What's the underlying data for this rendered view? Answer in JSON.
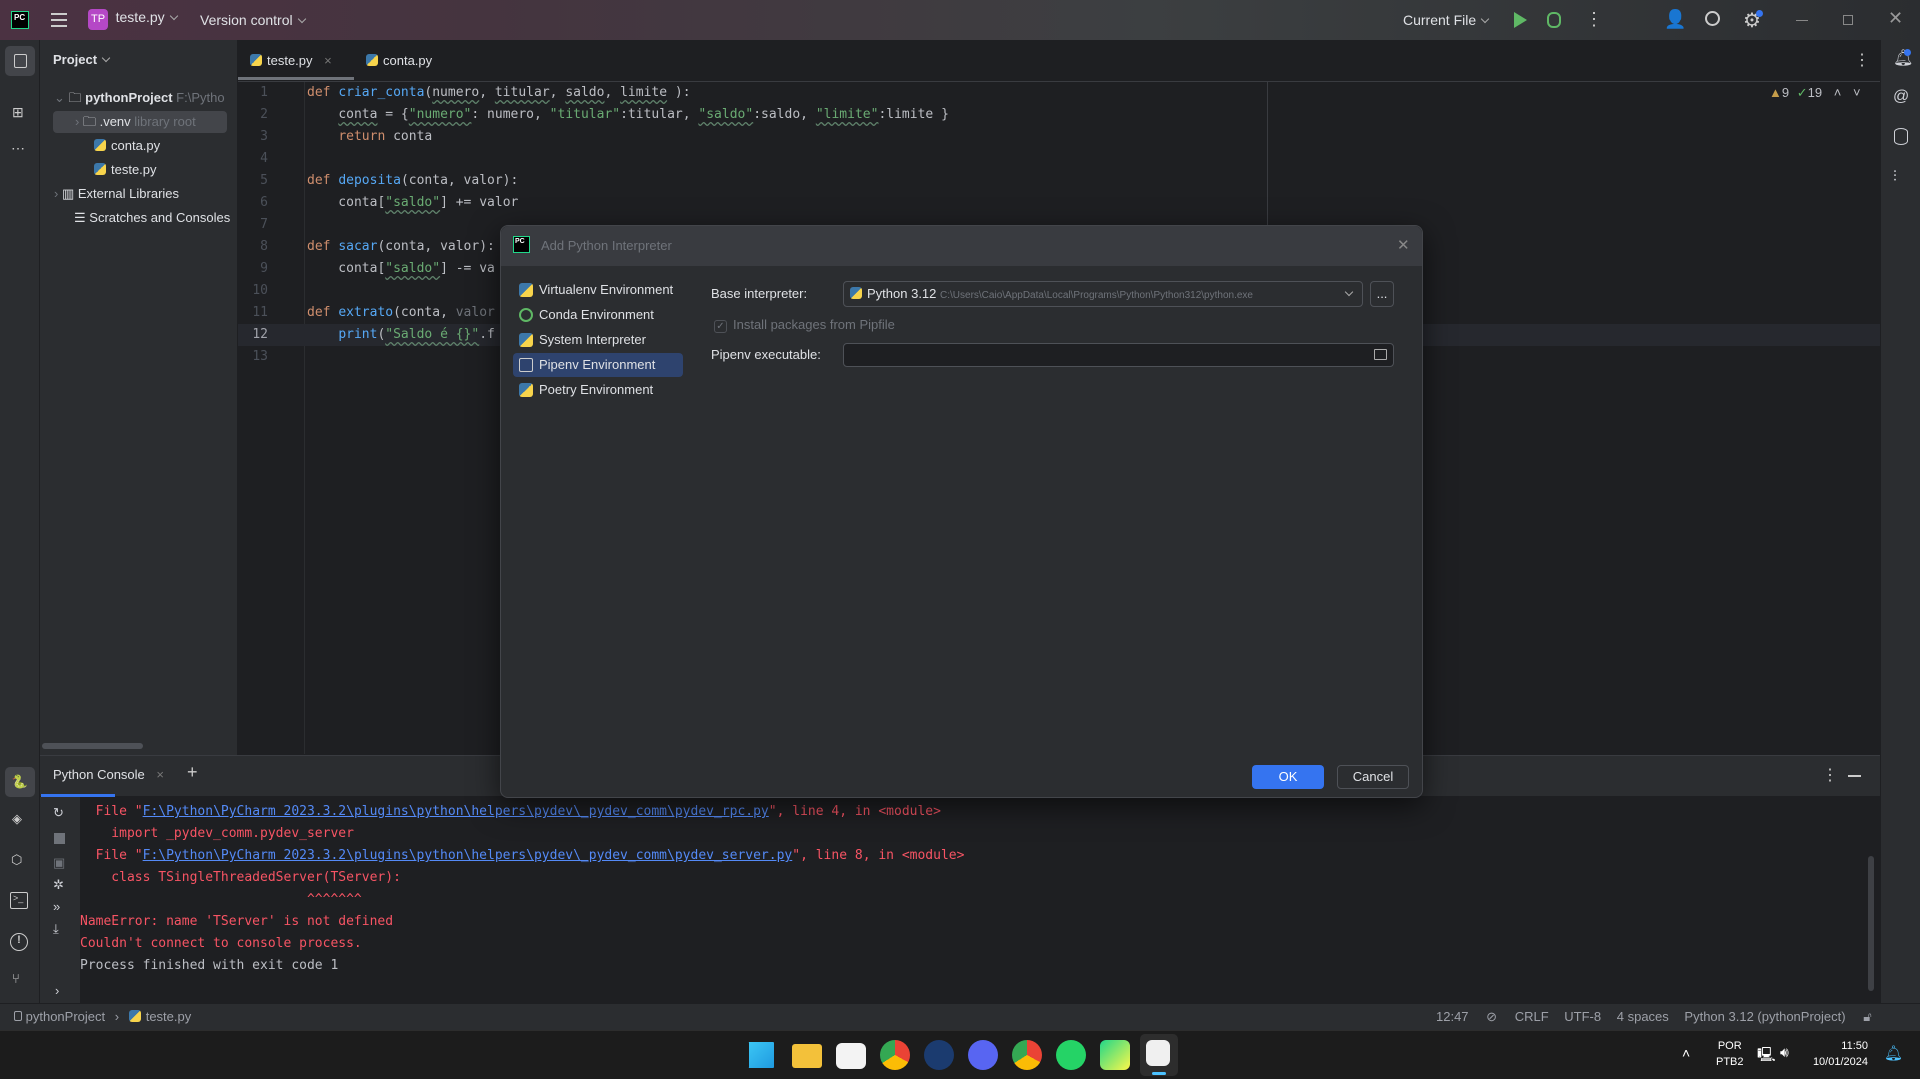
{
  "titlebar": {
    "project_badge": "TP",
    "project_name": "teste.py",
    "vcs": "Version control",
    "run_config": "Current File",
    "icons": [
      "app-logo-icon",
      "hamburger-menu-icon",
      "run-icon",
      "debug-icon",
      "more-icon",
      "add-user-icon",
      "search-icon",
      "settings-icon",
      "minimize-icon",
      "restore-icon",
      "close-icon"
    ]
  },
  "project_panel": {
    "title": "Project",
    "items": [
      {
        "label": "pythonProject",
        "hint": "F:\\Pytho",
        "icon": "folder-icon"
      },
      {
        "label": ".venv",
        "hint": "library root",
        "icon": "folder-icon"
      },
      {
        "label": "conta.py",
        "hint": "",
        "icon": "python-file-icon"
      },
      {
        "label": "teste.py",
        "hint": "",
        "icon": "python-file-icon"
      },
      {
        "label": "External Libraries",
        "hint": "",
        "icon": "library-icon"
      },
      {
        "label": "Scratches and Consoles",
        "hint": "",
        "icon": "scratches-icon"
      }
    ]
  },
  "editor": {
    "tabs": [
      {
        "label": "teste.py",
        "active": true
      },
      {
        "label": "conta.py",
        "active": false
      }
    ],
    "inspections": {
      "warnings": "9",
      "weak_warnings": "19"
    },
    "current_line": 12,
    "lines": [
      [
        [
          "k",
          "def "
        ],
        [
          "f",
          "criar_conta"
        ],
        [
          "p",
          "("
        ],
        [
          "pw",
          "numero"
        ],
        [
          "p",
          ", "
        ],
        [
          "pw",
          "titular"
        ],
        [
          "p",
          ", "
        ],
        [
          "pw",
          "saldo"
        ],
        [
          "p",
          ", "
        ],
        [
          "pw",
          "limite"
        ],
        [
          "p",
          " ):"
        ]
      ],
      [
        [
          "p",
          "    "
        ],
        [
          "pw",
          "conta"
        ],
        [
          "p",
          " = {"
        ],
        [
          "sw",
          "\"numero\""
        ],
        [
          "p",
          ": numero, "
        ],
        [
          "s",
          "\"titular\""
        ],
        [
          "p",
          ":titular, "
        ],
        [
          "sw",
          "\"saldo\""
        ],
        [
          "p",
          ":saldo, "
        ],
        [
          "sw",
          "\"limite\""
        ],
        [
          "p",
          ":limite }"
        ]
      ],
      [
        [
          "p",
          "    "
        ],
        [
          "k",
          "return"
        ],
        [
          "p",
          " conta"
        ]
      ],
      [],
      [
        [
          "k",
          "def "
        ],
        [
          "f",
          "deposita"
        ],
        [
          "p",
          "(conta, valor):"
        ]
      ],
      [
        [
          "p",
          "    conta["
        ],
        [
          "sw",
          "\"saldo\""
        ],
        [
          "p",
          "] += valor"
        ]
      ],
      [],
      [
        [
          "k",
          "def "
        ],
        [
          "f",
          "sacar"
        ],
        [
          "p",
          "(conta, valor):"
        ]
      ],
      [
        [
          "p",
          "    conta["
        ],
        [
          "sw",
          "\"saldo\""
        ],
        [
          "p",
          "] -= va"
        ]
      ],
      [],
      [
        [
          "k",
          "def "
        ],
        [
          "f",
          "extrato"
        ],
        [
          "p",
          "(conta, "
        ],
        [
          "g",
          "valor"
        ]
      ],
      [
        [
          "p",
          "    "
        ],
        [
          "f",
          "print"
        ],
        [
          "p",
          "("
        ],
        [
          "sw",
          "\"Saldo é {}\""
        ],
        [
          "p",
          ".f"
        ]
      ],
      []
    ]
  },
  "bottom_panel": {
    "tab": "Python Console",
    "console": [
      [
        [
          "e",
          "  File \""
        ],
        [
          "l",
          "F:\\Python\\PyCharm 2023.3.2\\plugins\\python\\helpers\\pydev\\_pydev_comm\\pydev_rpc.py"
        ],
        [
          "e",
          "\", line 4, in <module>"
        ]
      ],
      [
        [
          "e",
          "    import _pydev_comm.pydev_server"
        ]
      ],
      [
        [
          "e",
          "  File \""
        ],
        [
          "l",
          "F:\\Python\\PyCharm 2023.3.2\\plugins\\python\\helpers\\pydev\\_pydev_comm\\pydev_server.py"
        ],
        [
          "e",
          "\", line 8, in <module>"
        ]
      ],
      [
        [
          "e",
          "    class TSingleThreadedServer(TServer):"
        ]
      ],
      [
        [
          "e",
          "                             ^^^^^^^"
        ]
      ],
      [
        [
          "e",
          "NameError: name 'TServer' is not defined"
        ]
      ],
      [
        [
          "e",
          "Couldn't connect to console process."
        ]
      ],
      [
        [
          "n",
          "Process finished with exit code 1"
        ]
      ]
    ]
  },
  "dialog": {
    "title": "Add Python Interpreter",
    "environments": [
      {
        "label": "Virtualenv Environment",
        "selected": false
      },
      {
        "label": "Conda Environment",
        "selected": false
      },
      {
        "label": "System Interpreter",
        "selected": false
      },
      {
        "label": "Pipenv Environment",
        "selected": true
      },
      {
        "label": "Poetry Environment",
        "selected": false
      }
    ],
    "base_interpreter_label": "Base interpreter:",
    "base_interpreter_name": "Python 3.12",
    "base_interpreter_path": "C:\\Users\\Caio\\AppData\\Local\\Programs\\Python\\Python312\\python.exe",
    "browse_label": "...",
    "install_checkbox_label": "Install packages from Pipfile",
    "install_checked": true,
    "pipenv_label": "Pipenv executable:",
    "pipenv_value": "",
    "ok": "OK",
    "cancel": "Cancel"
  },
  "statusbar": {
    "breadcrumb": [
      "pythonProject",
      "teste.py"
    ],
    "position": "12:47",
    "line_sep": "CRLF",
    "encoding": "UTF-8",
    "indent": "4 spaces",
    "interpreter": "Python 3.12 (pythonProject)"
  },
  "taskbar": {
    "apps": [
      "windows-start-icon",
      "file-explorer-icon",
      "microsoft-store-icon",
      "chrome-icon",
      "steam-icon",
      "discord-icon",
      "chrome-profile-icon",
      "whatsapp-icon",
      "pycharm-icon",
      "snipping-tool-icon"
    ],
    "lang": "POR",
    "layout": "PTB2",
    "time": "11:50",
    "date": "10/01/2024"
  },
  "colors": {
    "accent": "#3574f0",
    "error": "#f75464",
    "link": "#548af7",
    "selection": "#2e436e"
  }
}
